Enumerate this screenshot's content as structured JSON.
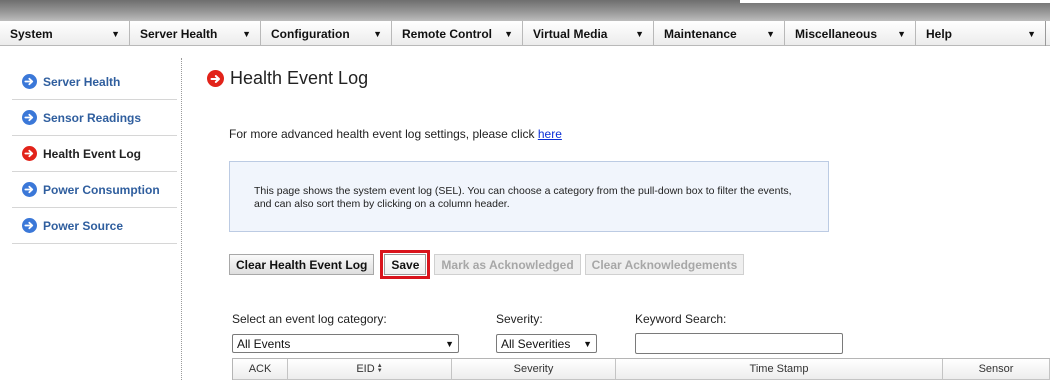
{
  "menu": [
    {
      "label": "System"
    },
    {
      "label": "Server Health"
    },
    {
      "label": "Configuration"
    },
    {
      "label": "Remote Control"
    },
    {
      "label": "Virtual Media"
    },
    {
      "label": "Maintenance"
    },
    {
      "label": "Miscellaneous"
    },
    {
      "label": "Help"
    }
  ],
  "sidebar": {
    "items": [
      {
        "label": "Server Health",
        "icon": "arrow-right-circle-icon"
      },
      {
        "label": "Sensor Readings",
        "icon": "arrow-right-circle-icon"
      },
      {
        "label": "Health Event Log",
        "icon": "arrow-right-circle-icon",
        "active": true
      },
      {
        "label": "Power Consumption",
        "icon": "arrow-right-circle-icon"
      },
      {
        "label": "Power Source",
        "icon": "arrow-right-circle-icon"
      }
    ]
  },
  "page": {
    "title": "Health Event Log",
    "settings_text": "For more advanced health event log settings, please click ",
    "settings_link": "here",
    "info_text": "This page shows the system event log (SEL). You can choose a category from the pull-down box to filter the events, and can also sort them by clicking on a column header."
  },
  "buttons": {
    "clear_log": "Clear Health Event Log",
    "save": "Save",
    "mark_ack": "Mark as Acknowledged",
    "clear_ack": "Clear Acknowledgements"
  },
  "filters": {
    "category_label": "Select an event log category:",
    "category_value": "All Events",
    "severity_label": "Severity:",
    "severity_value": "All Severities",
    "keyword_label": "Keyword Search:",
    "keyword_value": ""
  },
  "table": {
    "columns": [
      "ACK",
      "EID",
      "Severity",
      "Time Stamp",
      "Sensor"
    ]
  },
  "colors": {
    "accent_blue": "#3b78d8",
    "active_red": "#e2231a",
    "highlight_red": "#d9141c",
    "link": "#0b2fd6"
  }
}
